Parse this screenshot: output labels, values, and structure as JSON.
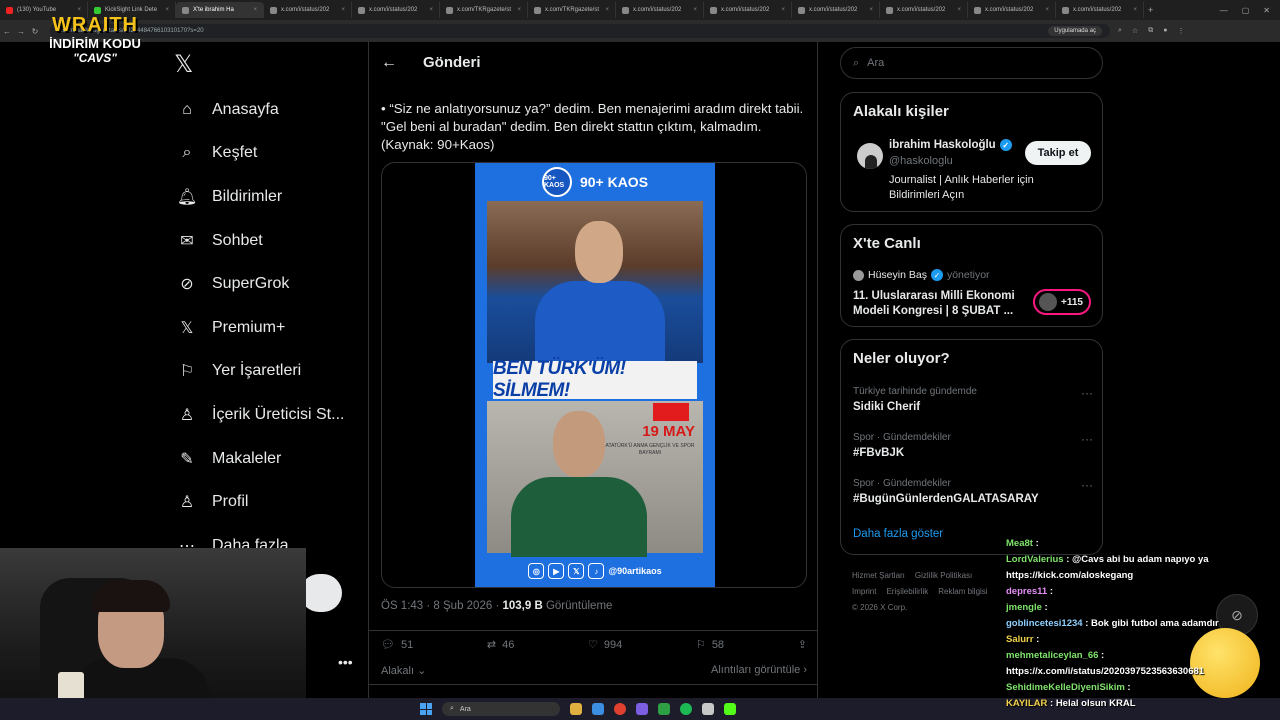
{
  "browser": {
    "tabs": [
      {
        "label": "(130) YouTube",
        "icon": "youtube-icon",
        "active": false
      },
      {
        "label": "KickSight Link Dete",
        "icon": "kicksight-icon",
        "active": false
      },
      {
        "label": "X'te ibrahim Ha",
        "icon": "x-icon",
        "active": true
      },
      {
        "label": "x.com/i/status/202",
        "icon": "x-icon",
        "active": false
      },
      {
        "label": "x.com/i/status/202",
        "icon": "x-icon",
        "active": false
      },
      {
        "label": "x.com/TKRgazete/st",
        "icon": "x-icon",
        "active": false
      },
      {
        "label": "x.com/TKRgazete/st",
        "icon": "x-icon",
        "active": false
      },
      {
        "label": "x.com/i/status/202",
        "icon": "x-icon",
        "active": false
      },
      {
        "label": "x.com/i/status/202",
        "icon": "x-icon",
        "active": false
      },
      {
        "label": "x.com/i/status/202",
        "icon": "x-icon",
        "active": false
      },
      {
        "label": "x.com/i/status/202",
        "icon": "x-icon",
        "active": false
      },
      {
        "label": "x.com/i/status/202",
        "icon": "x-icon",
        "active": false
      },
      {
        "label": "x.com/i/status/202",
        "icon": "x-icon",
        "active": false
      }
    ],
    "url": "x.com/haskologlu/status/2020448476610310170?s=20",
    "app_button": "Uygulamada aç"
  },
  "overlay": {
    "brand": "WRAITH",
    "code_label": "İNDİRİM KODU",
    "code": "\"CAVS\""
  },
  "nav": {
    "items": [
      {
        "label": "Anasayfa",
        "icon": "home-icon"
      },
      {
        "label": "Keşfet",
        "icon": "search-icon"
      },
      {
        "label": "Bildirimler",
        "icon": "bell-icon"
      },
      {
        "label": "Sohbet",
        "icon": "mail-icon"
      },
      {
        "label": "SuperGrok",
        "icon": "grok-icon"
      },
      {
        "label": "Premium+",
        "icon": "x-premium-icon"
      },
      {
        "label": "Yer İşaretleri",
        "icon": "bookmark-icon"
      },
      {
        "label": "İçerik Üreticisi St...",
        "icon": "creator-studio-icon"
      },
      {
        "label": "Makaleler",
        "icon": "articles-icon"
      },
      {
        "label": "Profil",
        "icon": "profile-icon"
      },
      {
        "label": "Daha fazla",
        "icon": "more-icon"
      }
    ]
  },
  "post": {
    "header_title": "Gönderi",
    "text_lines": [
      "• “Siz ne anlatıyorsunuz ya?” dedim. Ben menajerimi aradım direkt tabii.",
      "\"Gel beni al buradan\" dedim. Ben direkt stattın çıktım, kalmadım.",
      "(Kaynak: 90+Kaos)"
    ],
    "image": {
      "brand": "90+ KAOS",
      "badge": "90+ KAOS",
      "headline": "BEN TÜRK'ÜM! SİLMEM!",
      "date": "19 MAY",
      "subtitle": "ATATÜRK'Ü ANMA GENÇLİK VE SPOR BAYRAMI",
      "handle": "@90artikaos"
    },
    "time": "ÖS 1:43 · 8 Şub 2026 · ",
    "views_count": "103,9 B",
    "views_label": " Görüntüleme",
    "replies": "51",
    "reposts": "46",
    "likes": "994",
    "bookmarks": "58",
    "sort_label": "Alakalı",
    "quotes_label": "Alıntıları görüntüle"
  },
  "sidebar": {
    "search_placeholder": "Ara",
    "relevant_title": "Alakalı kişiler",
    "person": {
      "name": "ibrahim Haskoloğlu",
      "handle": "@haskologlu",
      "bio": "Journalist | Anlık Haberler için Bildirimleri Açın",
      "follow_label": "Takip et"
    },
    "live_title": "X'te Canlı",
    "live": {
      "host": "Hüseyin Baş",
      "role": "yönetiyor",
      "title": "11. Uluslararası Milli Ekonomi Modeli Kongresi | 8 ŞUBAT ...",
      "listeners": "+115"
    },
    "trends_title": "Neler oluyor?",
    "trends": [
      {
        "category": "Türkiye tarihinde gündemde",
        "name": "Sidiki Cherif"
      },
      {
        "category": "Spor · Gündemdekiler",
        "name": "#FBvBJK"
      },
      {
        "category": "Spor · Gündemdekiler",
        "name": "#BugünGünlerdenGALATASARAY"
      }
    ],
    "show_more": "Daha fazla göster",
    "footer": [
      "Hizmet Şartları",
      "Gizlilik Politikası",
      "Imprint",
      "Erişilebilirlik",
      "Reklam bilgisi",
      "© 2026 X Corp."
    ]
  },
  "chat": [
    {
      "user": "Mea8t",
      "msg": "",
      "color": "g"
    },
    {
      "user": "LordValerius",
      "msg": "@Cavs abi bu adam napıyo ya https://kick.com/aloskegang",
      "color": "g"
    },
    {
      "user": "depres11",
      "msg": "",
      "color": "p"
    },
    {
      "user": "jmengle",
      "msg": "",
      "color": "g"
    },
    {
      "user": "goblincetesi1234",
      "msg": "Bok gibi futbol ama adamdır",
      "color": "b"
    },
    {
      "user": "Salurr",
      "msg": "",
      "color": "y"
    },
    {
      "user": "mehmetaliceylan_66",
      "msg": "https://x.com/i/status/2020397523563630681",
      "color": "g"
    },
    {
      "user": "SehidimeKelleDiyeniSikim",
      "msg": "",
      "color": "g"
    },
    {
      "user": "KAYILAR",
      "msg": "Helal olsun KRAL",
      "color": "y"
    }
  ],
  "taskbar": {
    "search_placeholder": "Ara"
  }
}
